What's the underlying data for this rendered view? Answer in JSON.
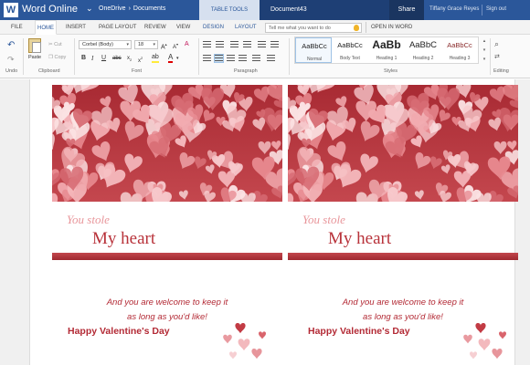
{
  "titlebar": {
    "app_name": "Word Online",
    "breadcrumb": [
      "OneDrive",
      "Documents"
    ],
    "tool_tab": "TABLE TOOLS",
    "doc_title": "Document43",
    "share": "Share",
    "user": "Tiffany Grace Reyes",
    "sign_out": "Sign out"
  },
  "tabs": [
    "FILE",
    "HOME",
    "INSERT",
    "PAGE LAYOUT",
    "REVIEW",
    "VIEW",
    "DESIGN",
    "LAYOUT"
  ],
  "tell_me": {
    "placeholder": "Tell me what you want to do"
  },
  "open_in_word": "OPEN IN WORD",
  "ribbon": {
    "groups": [
      "Undo",
      "Clipboard",
      "Font",
      "Paragraph",
      "Styles",
      "Editing"
    ],
    "paste": "Paste",
    "cut": "Cut",
    "copy": "Copy",
    "font_name": "Corbel (Body)",
    "font_size": "18",
    "styles": [
      {
        "sample": "AaBbCc",
        "name": "Normal"
      },
      {
        "sample": "AaBbCc",
        "name": "Body Text"
      },
      {
        "sample": "AaBb",
        "name": "Heading 1"
      },
      {
        "sample": "AaBbC",
        "name": "Heading 2"
      },
      {
        "sample": "AaBbCc",
        "name": "Heading 3"
      }
    ]
  },
  "cards": [
    {
      "stole": "You stole",
      "heart": "My heart",
      "msg1": "And you are welcome to keep it",
      "msg2": "as long as you'd like!",
      "vday": "Happy Valentine's Day"
    },
    {
      "stole": "You stole",
      "heart": "My heart",
      "msg1": "And you are welcome to keep it",
      "msg2": "as long as you'd like!",
      "vday": "Happy Valentine's Day"
    }
  ],
  "colors": {
    "brand": "#2b579a",
    "accent_red": "#b32a35",
    "pink": "#e8959a"
  }
}
